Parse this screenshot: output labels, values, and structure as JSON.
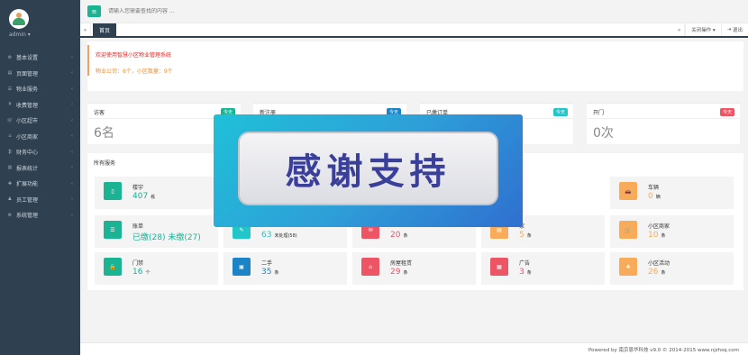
{
  "sidebar": {
    "username": "admin ▾",
    "items": [
      {
        "label": "基本设置",
        "icon": "gear-icon"
      },
      {
        "label": "页面管理",
        "icon": "page-icon"
      },
      {
        "label": "物业服务",
        "icon": "service-icon"
      },
      {
        "label": "收费管理",
        "icon": "fee-icon"
      },
      {
        "label": "小区超市",
        "icon": "cart-icon"
      },
      {
        "label": "小区商家",
        "icon": "shop-icon"
      },
      {
        "label": "财务中心",
        "icon": "finance-icon"
      },
      {
        "label": "报表统计",
        "icon": "report-icon"
      },
      {
        "label": "扩展功能",
        "icon": "extend-icon"
      },
      {
        "label": "员工管理",
        "icon": "staff-icon"
      },
      {
        "label": "系统管理",
        "icon": "system-icon"
      }
    ]
  },
  "header": {
    "search_placeholder": "请输入您需要查找的内容 ..."
  },
  "tabs": {
    "active": "首页",
    "close_ops": "关闭操作 ▾",
    "exit": "退出"
  },
  "welcome": {
    "line1": "欢迎使用智慧小区物业管理系统",
    "line2": "物业公司：6个，小区数量：9个"
  },
  "stats": [
    {
      "title": "访客",
      "badge": "今天",
      "badge_color": "#1ab394",
      "value": "6名"
    },
    {
      "title": "新注册",
      "badge": "今天",
      "badge_color": "#1c84c6",
      "value": ""
    },
    {
      "title": "已缴订单",
      "badge": "今天",
      "badge_color": "#23c6c8",
      "value": ""
    },
    {
      "title": "开门",
      "badge": "今天",
      "badge_color": "#ed5565",
      "value": "0次"
    }
  ],
  "services": {
    "title": "所有服务",
    "items": [
      {
        "name": "楼宇",
        "count": "407",
        "unit": "栋",
        "color": "#1ab394",
        "icon": "building-icon"
      },
      {
        "name": "车辆",
        "count": "0",
        "unit": "辆",
        "color": "#f8ac59",
        "icon": "car-icon"
      },
      {
        "name": "账单",
        "count": "已缴(28) 未缴(27)",
        "unit": "",
        "color": "#1ab394",
        "icon": "bill-icon"
      },
      {
        "name": "",
        "count": "63",
        "unit": "未处理(58)",
        "color": "#23c6c8",
        "icon": "repair-icon"
      },
      {
        "name": "",
        "count": "20",
        "unit": "条",
        "color": "#ed5565",
        "icon": "complaint-icon"
      },
      {
        "name": "家",
        "count": "5",
        "unit": "条",
        "color": "#f8ac59",
        "icon": "notice-icon"
      },
      {
        "name": "小区商家",
        "count": "10",
        "unit": "条",
        "color": "#f8ac59",
        "icon": "merchant-icon"
      },
      {
        "name": "门禁",
        "count": "16",
        "unit": "个",
        "color": "#1ab394",
        "icon": "lock-icon"
      },
      {
        "name": "二手",
        "count": "35",
        "unit": "条",
        "color": "#1c84c6",
        "icon": "box-icon"
      },
      {
        "name": "房屋租赁",
        "count": "29",
        "unit": "条",
        "color": "#ed5565",
        "icon": "house-icon"
      },
      {
        "name": "广告",
        "count": "3",
        "unit": "条",
        "color": "#ed5565",
        "icon": "ad-icon"
      },
      {
        "name": "小区活动",
        "count": "26",
        "unit": "条",
        "color": "#f8ac59",
        "icon": "gift-icon"
      }
    ]
  },
  "popup": {
    "text": "感谢支持"
  },
  "footer": {
    "text": "Powered by 南京恩华科技 v9.0 © 2014-2015 www.njzhsq.com"
  }
}
